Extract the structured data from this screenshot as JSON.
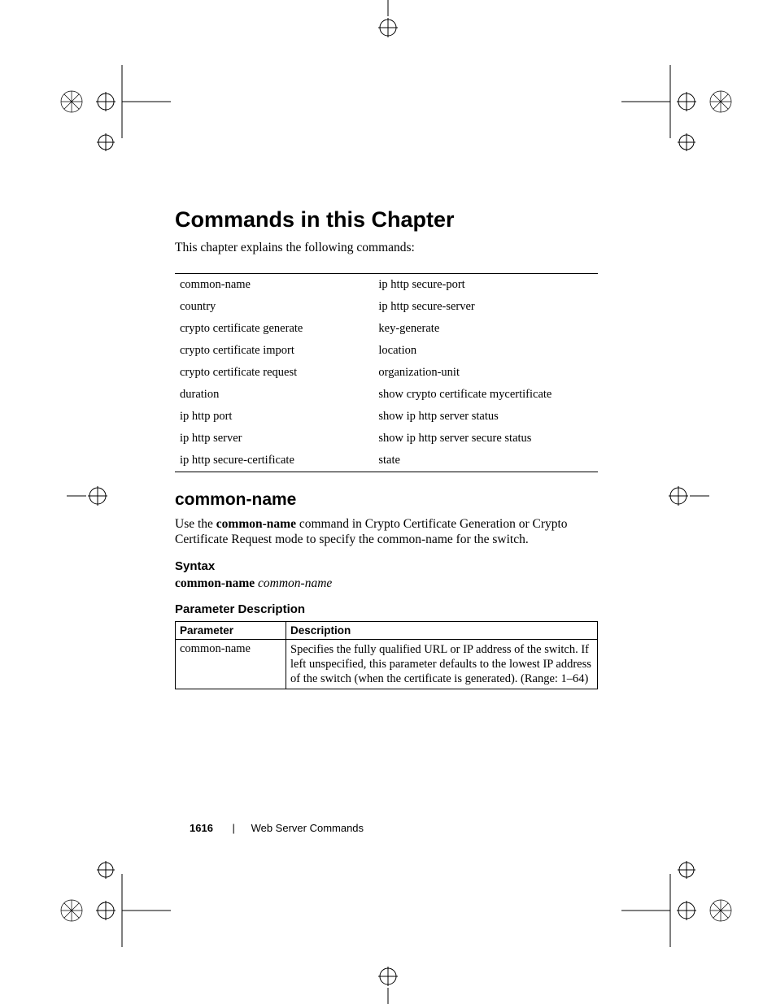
{
  "headings": {
    "chapter": "Commands in this Chapter",
    "intro": "This chapter explains the following commands:",
    "section": "common-name",
    "syntax": "Syntax",
    "param_desc": "Parameter Description"
  },
  "command_list": {
    "rows": [
      {
        "left": "common-name",
        "right": "ip http secure-port"
      },
      {
        "left": "country",
        "right": "ip http secure-server"
      },
      {
        "left": "crypto certificate generate",
        "right": "key-generate"
      },
      {
        "left": "crypto certificate import",
        "right": "location"
      },
      {
        "left": "crypto certificate request",
        "right": "organization-unit"
      },
      {
        "left": "duration",
        "right": "show crypto certificate mycertificate"
      },
      {
        "left": "ip http port",
        "right": "show ip http server status"
      },
      {
        "left": "ip http server",
        "right": "show ip http server secure status"
      },
      {
        "left": "ip http secure-certificate",
        "right": "state"
      }
    ]
  },
  "section_body": {
    "use_prefix": "Use the ",
    "use_bold": "common-name",
    "use_suffix": " command in Crypto Certificate Generation or Crypto Certificate Request mode to specify the common-name for the switch."
  },
  "syntax_line": {
    "bold": "common-name",
    "ital": "common-name"
  },
  "param_table": {
    "headers": {
      "param": "Parameter",
      "desc": "Description"
    },
    "rows": [
      {
        "param": "common-name",
        "desc": "Specifies the fully qualified URL or IP address of the switch. If left unspecified, this parameter defaults to the lowest IP address of the switch (when the certificate is generated). (Range: 1–64)"
      }
    ]
  },
  "footer": {
    "page_number": "1616",
    "separator": "|",
    "title": "Web Server Commands"
  }
}
